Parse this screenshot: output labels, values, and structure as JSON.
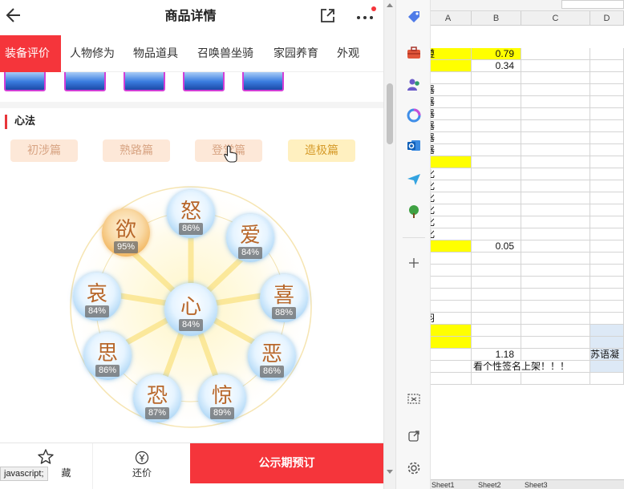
{
  "app": {
    "title": "商品详情",
    "tabs": [
      {
        "label": "装备评价",
        "active": true
      },
      {
        "label": "人物修为"
      },
      {
        "label": "物品道具"
      },
      {
        "label": "召唤兽坐骑"
      },
      {
        "label": "家园养育"
      },
      {
        "label": "外观"
      }
    ],
    "section_title": "心法",
    "levels": [
      "初涉篇",
      "熟路篇",
      "登堂篇",
      "造极篇"
    ],
    "emotions": [
      {
        "char": "欲",
        "pct": "95%"
      },
      {
        "char": "怒",
        "pct": "86%"
      },
      {
        "char": "爱",
        "pct": "84%"
      },
      {
        "char": "哀",
        "pct": "84%"
      },
      {
        "char": "心",
        "pct": "84%"
      },
      {
        "char": "喜",
        "pct": "88%"
      },
      {
        "char": "思",
        "pct": "86%"
      },
      {
        "char": "恶",
        "pct": "86%"
      },
      {
        "char": "恐",
        "pct": "87%"
      },
      {
        "char": "惊",
        "pct": "89%"
      }
    ],
    "bottom": {
      "favorite_label": "藏",
      "bargain_label": "还价",
      "primary_label": "公示期预订"
    },
    "status_text": "javascript;",
    "accent": "#f5353b"
  },
  "sheet": {
    "columns": [
      "A",
      "B",
      "C",
      "D"
    ],
    "cells": {
      "r0_a": "遵",
      "r0_b": "0.79",
      "r1_b": "0.34",
      "r3_a": "器",
      "r4_a": "器",
      "r5_a": "器",
      "r6_a": "器",
      "r7_a": "器",
      "r8_a": "器",
      "r10_a": "化",
      "r11_a": "化",
      "r12_a": "化",
      "r13_a": "化",
      "r14_a": "化",
      "r15_a": "化",
      "r16_b": "0.05",
      "r22_a": "羽",
      "r25_b": "1.18",
      "r25_d": "苏语凝",
      "r26_b": "看个性签名上架！！！"
    },
    "tabs": [
      "Sheet1",
      "Sheet2",
      "Sheet3"
    ]
  }
}
